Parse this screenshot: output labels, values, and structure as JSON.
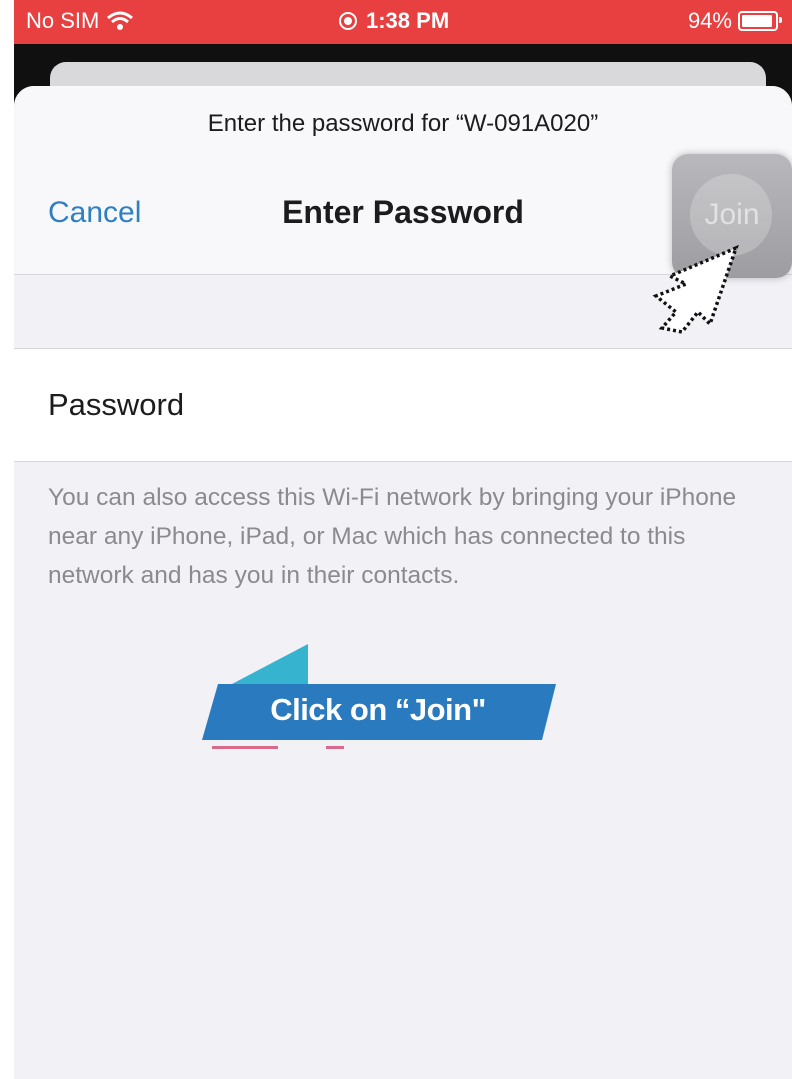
{
  "status_bar": {
    "carrier": "No SIM",
    "time": "1:38 PM",
    "battery": "94%",
    "battery_level": 0.94
  },
  "sheet": {
    "prompt": "Enter the password for “W-091A020”",
    "cancel_label": "Cancel",
    "title": "Enter Password",
    "join_label": "Join"
  },
  "password_field": {
    "label": "Password",
    "value": ""
  },
  "info_text": "You can also access this Wi-Fi network by bringing your iPhone near any iPhone, iPad, or Mac which has connected to this network and has you in their contacts.",
  "annotation": {
    "banner_text": "Click on “Join\"",
    "pointer_icon": "hand-pointer-icon"
  },
  "colors": {
    "status_bar": "#e84040",
    "accent": "#2f80c2",
    "banner_blue": "#2a7ac0",
    "banner_teal": "#35b3cf"
  }
}
